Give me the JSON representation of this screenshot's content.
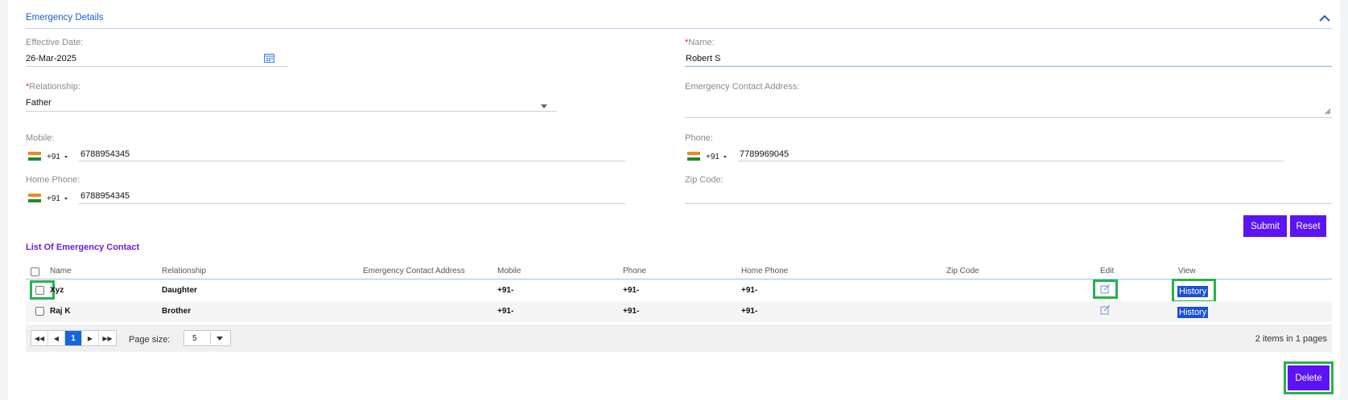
{
  "section": {
    "title": "Emergency Details"
  },
  "form": {
    "effective_date_label": "Effective Date:",
    "effective_date_value": "26-Mar-2025",
    "name_label": "Name:",
    "name_value": "Robert S",
    "relationship_label": "Relationship:",
    "relationship_value": "Father",
    "address_label": "Emergency Contact Address:",
    "address_value": "",
    "mobile_label": "Mobile:",
    "mobile_code": "+91",
    "mobile_value": "6788954345",
    "phone_label": "Phone:",
    "phone_code": "+91",
    "phone_value": "7789969045",
    "home_phone_label": "Home Phone:",
    "home_phone_code": "+91",
    "home_phone_value": "6788954345",
    "zip_label": "Zip Code:",
    "zip_value": "",
    "required_mark": "*"
  },
  "buttons": {
    "submit": "Submit",
    "reset": "Reset",
    "delete": "Delete"
  },
  "list": {
    "title": "List Of Emergency Contact",
    "columns": [
      "Name",
      "Relationship",
      "Emergency Contact Address",
      "Mobile",
      "Phone",
      "Home Phone",
      "Zip Code",
      "Edit",
      "View"
    ],
    "rows": [
      {
        "name": "Xyz",
        "relationship": "Daughter",
        "address": "",
        "mobile": "+91-",
        "phone": "+91-",
        "home_phone": "+91-",
        "zip": "",
        "view": "History"
      },
      {
        "name": "Raj K",
        "relationship": "Brother",
        "address": "",
        "mobile": "+91-",
        "phone": "+91-",
        "home_phone": "+91-",
        "zip": "",
        "view": "History"
      }
    ]
  },
  "pager": {
    "current_page": "1",
    "page_size_label": "Page size:",
    "page_size": "5",
    "info": "2 items in 1 pages"
  },
  "colors": {
    "accent": "#5b14f5",
    "highlight": "#27b24a",
    "link_blue": "#1b5fd0"
  },
  "icons": [
    "chevron-up-icon",
    "calendar-icon",
    "india-flag-icon",
    "edit-icon",
    "first-page-icon",
    "prev-page-icon",
    "next-page-icon",
    "last-page-icon"
  ]
}
